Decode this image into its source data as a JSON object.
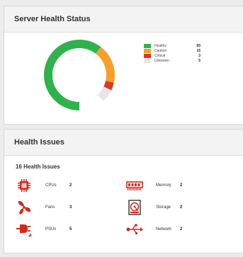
{
  "server_health": {
    "title": "Server Health Status",
    "legend": [
      {
        "label": "Healthy",
        "value": 60,
        "color": "#2fb24c"
      },
      {
        "label": "Caution",
        "value": 15,
        "color": "#f5a02a"
      },
      {
        "label": "Critical",
        "value": 3,
        "color": "#d93a2b"
      },
      {
        "label": "Unknown",
        "value": 5,
        "color": "#e6e6e6"
      }
    ]
  },
  "health_issues": {
    "title": "Health Issues",
    "summary": "16 Health Issues",
    "items": [
      {
        "name": "CPUs",
        "count": "2",
        "icon": "cpu-icon"
      },
      {
        "name": "Memory",
        "count": "2",
        "icon": "memory-icon"
      },
      {
        "name": "Fans",
        "count": "3",
        "icon": "fan-icon"
      },
      {
        "name": "Storage",
        "count": "2",
        "icon": "storage-icon"
      },
      {
        "name": "PSUs",
        "count": "5",
        "icon": "psu-icon"
      },
      {
        "name": "Network",
        "count": "2",
        "icon": "network-icon"
      }
    ]
  },
  "colors": {
    "issue_icon": "#d4281c",
    "network_icon": "#d4281c"
  }
}
